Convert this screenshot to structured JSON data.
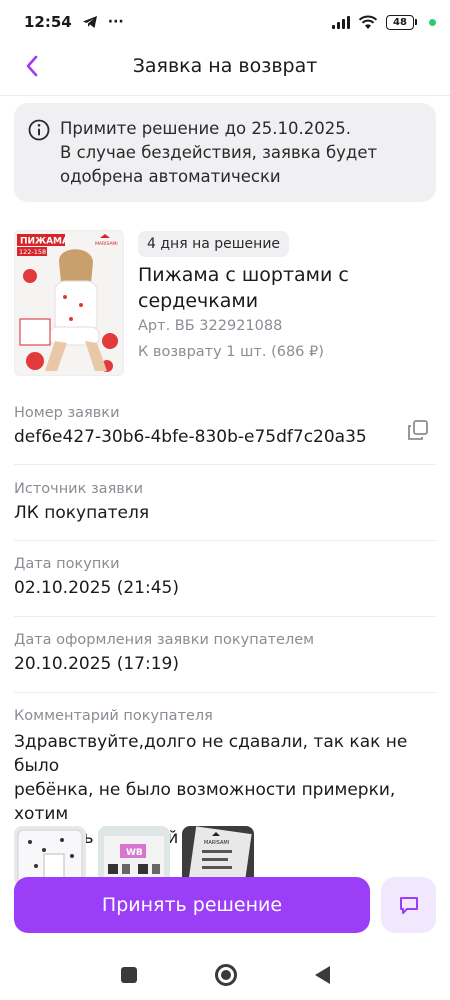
{
  "status_bar": {
    "time": "12:54",
    "extra": "···",
    "battery": "48"
  },
  "header": {
    "title": "Заявка на возврат"
  },
  "banner": {
    "line1": "Примите решение до 25.10.2025.",
    "line2": "В случае бездействия, заявка будет",
    "line3": "одобрена автоматически"
  },
  "product": {
    "image_title": "ПИЖАМА",
    "image_sizes": "122-158",
    "image_brand": "MARISAMI",
    "badge": "4 дня на решение",
    "name_line1": "Пижама с шортами с",
    "name_line2": "сердечками",
    "article": "Арт. ВБ 322921088",
    "quantity": "К возврату 1 шт. (686 ₽)"
  },
  "fields": {
    "order_number_label": "Номер заявки",
    "order_number_value": "def6e427-30b6-4bfe-830b-e75df7c20a35",
    "source_label": "Источник заявки",
    "source_value": "ЛК покупателя",
    "purchase_date_label": "Дата покупки",
    "purchase_date_value": "02.10.2025 (21:45)",
    "created_date_label": "Дата оформления заявки покупателем",
    "created_date_value": "20.10.2025 (17:19)",
    "comment_label": "Комментарий покупателя",
    "comment_line1": "Здравствуйте,долго не сдавали, так как не было",
    "comment_line2": "ребёнка, не было возможности примерки, хотим",
    "comment_line3": "заказать больший размер."
  },
  "attachments": {
    "thumb2_label": "WB",
    "thumb3_label": "MARISAMI"
  },
  "actions": {
    "accept_label": "Принять решение"
  },
  "colors": {
    "accent": "#9b3ef7",
    "accent_light": "#f1e8fd",
    "banner_bg": "#f0f0f3",
    "muted_text": "#8c8c95"
  },
  "icons": {
    "back": "chevron-left-icon",
    "info": "info-icon",
    "copy": "copy-icon",
    "chat": "chat-icon",
    "telegram": "telegram-icon",
    "wifi": "wifi-icon",
    "signal": "signal-icon"
  }
}
